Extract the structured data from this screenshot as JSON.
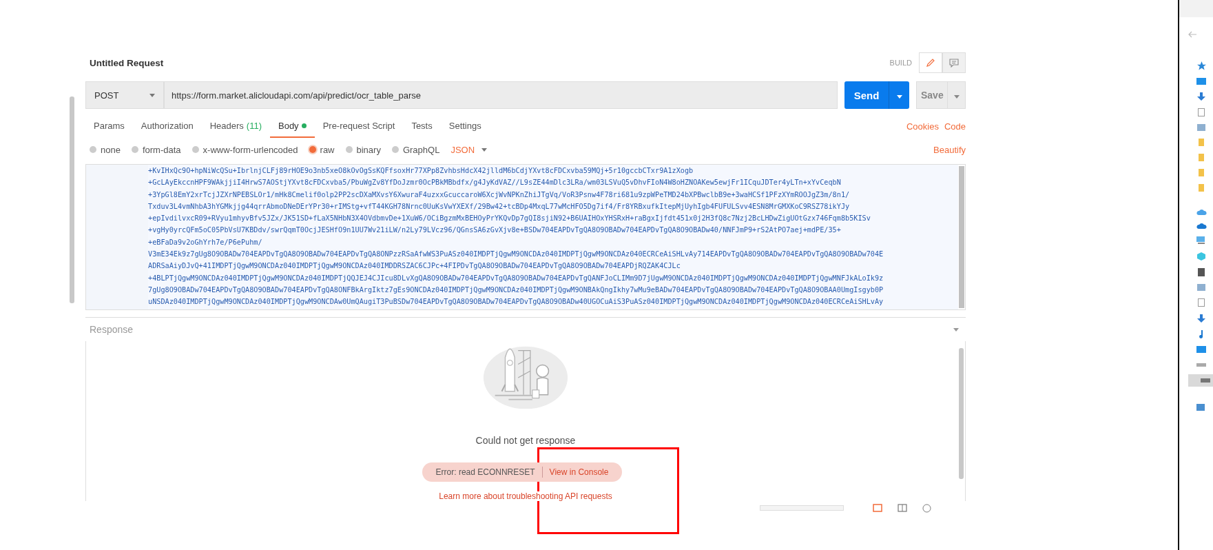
{
  "request": {
    "title": "Untitled Request",
    "mode_label": "BUILD",
    "method": "POST",
    "url": "https://form.market.alicloudapi.com/api/predict/ocr_table_parse",
    "send_label": "Send",
    "save_label": "Save"
  },
  "tabs": [
    {
      "label": "Params",
      "selected": false
    },
    {
      "label": "Authorization",
      "selected": false
    },
    {
      "label": "Headers",
      "count": "(11)",
      "selected": false
    },
    {
      "label": "Body",
      "dot": true,
      "selected": true
    },
    {
      "label": "Pre-request Script",
      "selected": false
    },
    {
      "label": "Tests",
      "selected": false
    },
    {
      "label": "Settings",
      "selected": false
    }
  ],
  "tab_links": [
    "Cookies",
    "Code"
  ],
  "body_types": [
    {
      "label": "none",
      "selected": false
    },
    {
      "label": "form-data",
      "selected": false
    },
    {
      "label": "x-www-form-urlencoded",
      "selected": false
    },
    {
      "label": "raw",
      "selected": true
    },
    {
      "label": "binary",
      "selected": false
    },
    {
      "label": "GraphQL",
      "selected": false
    }
  ],
  "format": "JSON",
  "beautify": "Beautify",
  "body_lines": [
    "+KvIHxQc9O+hpNiWcQSu+IbrlnjCLFj89rHOE9o3nb5xeO8kOvOgSsKQFfsoxHr77XPp8ZvhbsHdcX42jlldM6bCdjYXvt8cFDCxvba59MQj+5r10gccbCTxr9A1zXogb",
    "+GcLAyEkccnHPF9WAkjjiI4HrwS7AOStjYXvt8cFDCxvba5/PbuWgZv8YfDoJzmr0OcPBkMBbdfx/g4JyKdVAZ//L9sZE44mDlc3LRa/wm03LSVuQ5vDhvFIoN4W8oHZNOAKew5ewjFr1ICquJDTer4yLTn+xYvCeqbN",
    "+3YpGl8EmY2xrTcjJZXrNPEBSLOr1/mHk8Cmelif0olp2PP2scDXaMXvsY6XwuraF4uzxxGcuccaroW6XcjWvNPKnZhiJTgVq/VoR3Psnw4F78ri681u9zpWPeTMD24bXPBwclbB9e+3waHCSf1PFzXYmROOJgZ3m/8n1/",
    "Txduv3L4vmNhbA3hYGMkjjg44qrrAbmoDNeDErYPr30+rIMStg+vfT44KGH78Nrnc0UuKsVwYXEXf/29Bw42+tcBDp4MxqL77wMcHFO5Dg7if4/Fr8YRBxufkItepMjUyhIgb4FUFULSvv4ESN8MrGMXKoC9RSZ78ikYJy",
    "+epIvdilvxcR09+RVyu1mhyvBfv5JZx/JK51SD+fLaX5NHbN3X4OVdbmvDe+1XuW6/OCiBgzmMxBEHOyPrYKQvDp7gQI8sjiN92+B6UAIHOxYHSRxH+raBgxIjfdt451x0j2H3fQ8c7Nzj2BcLHDwZigUOtGzx746Fqm8b5KISv",
    "+vgHy0yrcQFm5oC05PbVsU7KBDdv/swrQqmT0OcjJESHfO9n1UU7Wv21iLW/n2Ly79LVcz96/QGnsSA6zGvXjv8e+BSDw704EAPDvTgQA8O9OBADw704EAPDvTgQA8O9OBADw40/NNFJmP9+rS2AtPO7aej+mdPE/35+",
    "+eBFaDa9v2oGhYrh7e/P6ePuhm/",
    "V3mE34Ek9z7gUg8O9OBADw704EAPDvTgQA8O9OBADw704EAPDvTgQA8ONPzzRSaAfwWS3PuASz040IMDPTjQgwM9ONCDAz040IMDPTjQgwM9ONCDAz040ECRCeAiSHLvAy714EAPDvTgQA8O9OBADw704EAPDvTgQA8O9OBADw704E",
    "ADRSaAiyDJvQ+41IMDPTjQgwM9ONCDAz040IMDPTjQgwM9ONCDAz040IMDDRSZAC6CJPc+4FIPDvTgQA8O9OBADw704EAPDvTgQA8O9OBADw704EAPDjRQZAK4CJLc",
    "+4BLPTjQgwM9ONCDAz040IMDPTjQgwM9ONCDAz040IMDPTjQQJEJ4CJIcu8DLvXgQA8O9OBADw704EAPDvTgQA8O9OBADw704EAPDvTgQANFJoCLIMm9D7jUgwM9ONCDAz040IMDPTjQgwM9ONCDAz040IMDPTjQgwMNFJkALoIk9z",
    "7gUg8O9OBADw704EAPDvTgQA8O9OBADw704EAPDvTgQA8ONFBkArgIktz7gEs9ONCDAz040IMDPTjQgwM9ONCDAz040IMDPTjQgwM9ONBAkQngIkhy7wMu9eBADw704EAPDvTgQA8O9OBADw704EAPDvTgQA8O9OBAA0UmgIsgyb0P",
    "uNSDAz040IMDPTjQgwM9ONCDAz040IMDPTjQgwM9ONCDAw0UmQAugiT3PuBSDw704EAPDvTgQA8O9OBADw704EAPDvTgQA8O9OBADw40UGOCuAiS3PuASz040IMDPTjQgwM9ONCDAz040IMDPTjQgwM9ONCDAz040ECRCeAiSHLvAy"
  ],
  "response": {
    "title": "Response",
    "message": "Could not get response",
    "error": "Error: read ECONNRESET",
    "console_link": "View in Console",
    "help_link": "Learn more about troubleshooting API requests"
  }
}
